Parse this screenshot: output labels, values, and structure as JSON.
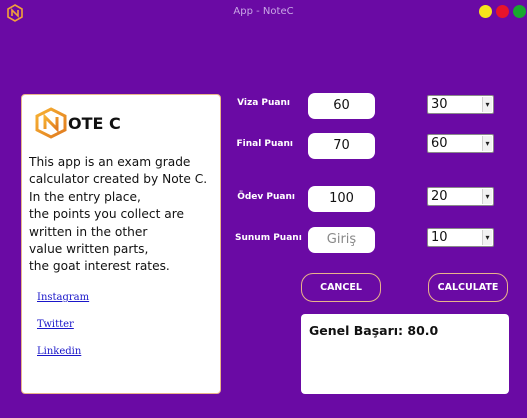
{
  "window": {
    "title": "App - NoteC",
    "buttons": [
      "minimize",
      "close",
      "maximize"
    ]
  },
  "brand": {
    "name": "OTE C"
  },
  "about": {
    "lines": [
      "This app is an exam grade",
      "calculator created by Note C.",
      "In the entry place,",
      "the points you collect are",
      "written in the other",
      "value written parts,",
      "the goat interest rates."
    ]
  },
  "links": {
    "instagram": "Instagram",
    "twitter": "Twitter",
    "linkedin": "Linkedin"
  },
  "form": {
    "viza": {
      "label": "Viza Puanı",
      "value": "60",
      "percent": "30"
    },
    "final": {
      "label": "Final Puanı",
      "value": "70",
      "percent": "60"
    },
    "odev": {
      "label": "Ödev Puanı",
      "value": "100",
      "percent": "20"
    },
    "sunum": {
      "label": "Sunum Puanı",
      "value": "",
      "placeholder": "Giriş",
      "percent": "10"
    }
  },
  "actions": {
    "cancel": "CANCEL",
    "calculate": "CALCULATE"
  },
  "result": {
    "text": "Genel Başarı: 80.0"
  },
  "colors": {
    "background": "#6a0aa4",
    "accent_border": "#e9b48a",
    "link": "#1a16c9"
  }
}
